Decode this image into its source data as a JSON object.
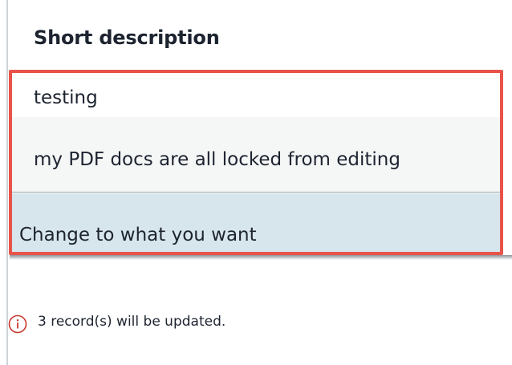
{
  "column": {
    "header": "Short description"
  },
  "cells": [
    {
      "value": "testing"
    },
    {
      "value": "my PDF docs are all locked from editing"
    },
    {
      "value": "Change to what you want"
    }
  ],
  "status": {
    "icon": "info-icon",
    "message": "3 record(s) will be updated.",
    "icon_color": "#c9382f"
  },
  "colors": {
    "highlight_border": "#e8534a",
    "selected_row": "#d7e6ec"
  }
}
